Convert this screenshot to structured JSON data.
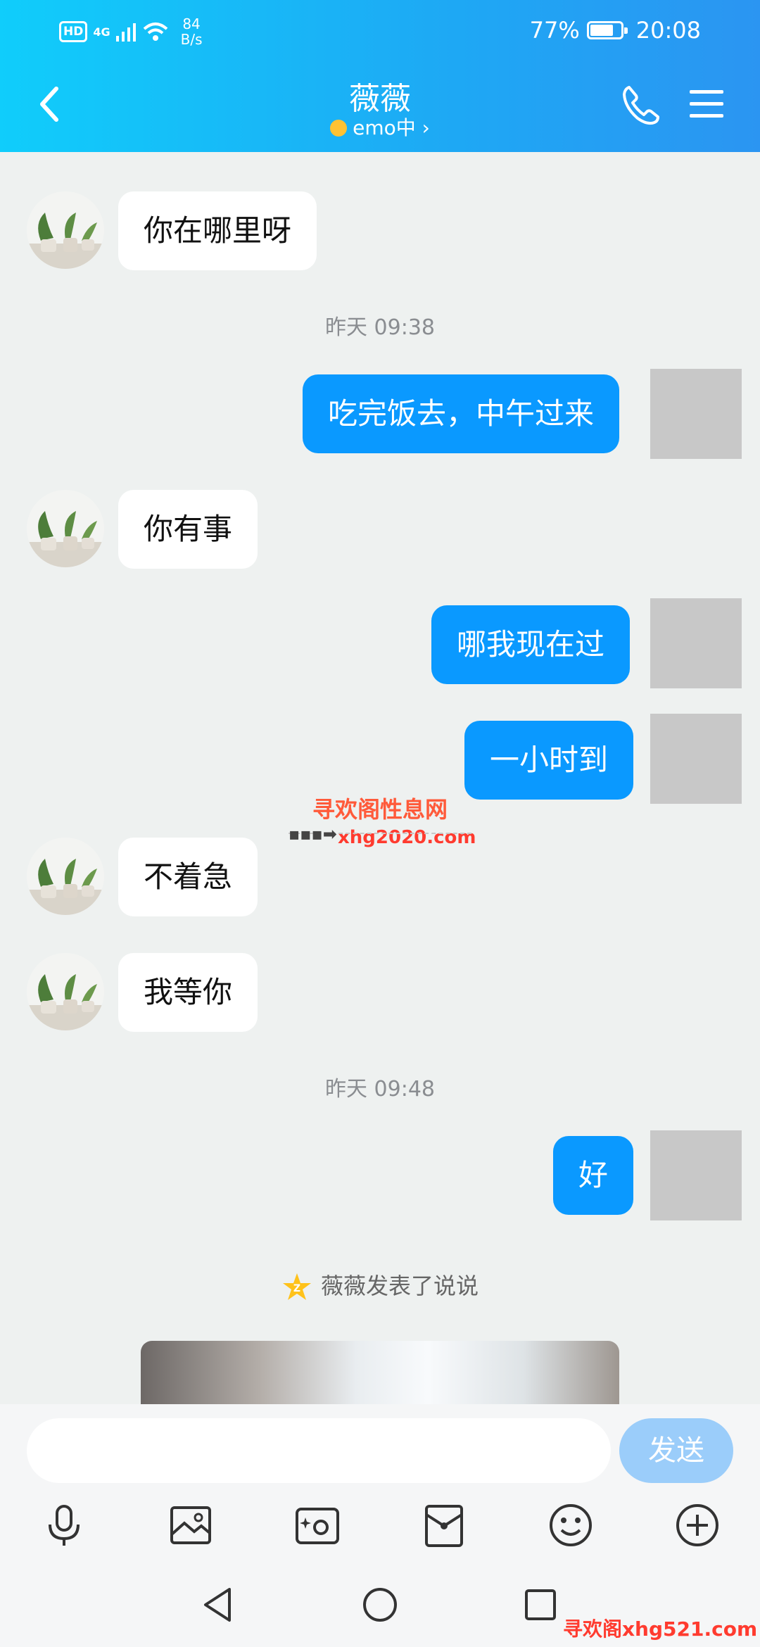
{
  "status_bar": {
    "hd": "HD",
    "network": "4G",
    "speed_value": "84",
    "speed_unit": "B/s",
    "battery_percent": "77%",
    "battery_level": 0.77,
    "time": "20:08"
  },
  "header": {
    "title": "薇薇",
    "subtitle": "emo中 ›"
  },
  "messages": [
    {
      "side": "in",
      "text": "你在哪里呀"
    },
    {
      "type": "time",
      "text": "昨天 09:38"
    },
    {
      "side": "out",
      "text": "吃完饭去，中午过来"
    },
    {
      "side": "in",
      "text": "你有事"
    },
    {
      "side": "out",
      "text": "哪我现在过"
    },
    {
      "side": "out",
      "text": "一小时到"
    },
    {
      "side": "in",
      "text": "不着急"
    },
    {
      "side": "in",
      "text": "我等你"
    },
    {
      "type": "time",
      "text": "昨天 09:48"
    },
    {
      "side": "out",
      "text": "好"
    }
  ],
  "watermark": {
    "title": "寻欢阁性息网",
    "url": "xhg2020.com"
  },
  "qzone_notice": "薇薇发表了说说",
  "input": {
    "placeholder": "",
    "send_label": "发送"
  },
  "toolbar_icons": [
    "microphone-icon",
    "image-icon",
    "camera-icon",
    "red-packet-icon",
    "emoji-icon",
    "plus-icon"
  ],
  "footer_watermark": "寻欢阁xhg521.com",
  "colors": {
    "header_start": "#10cdfb",
    "header_end": "#2b95f2",
    "outgoing_bubble": "#0a99ff",
    "incoming_bubble": "#ffffff",
    "send_button": "#9bcdfa"
  }
}
